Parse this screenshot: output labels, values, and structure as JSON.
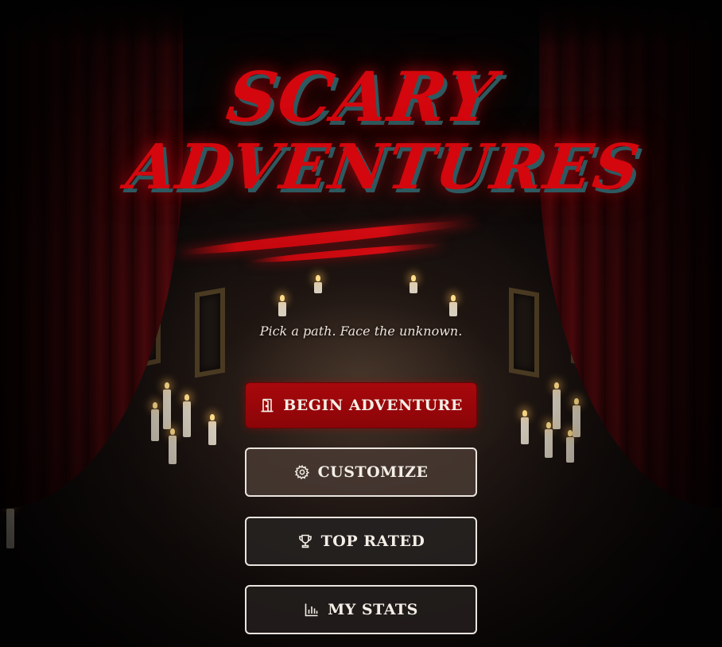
{
  "game": {
    "title_line_1": "SCARY",
    "title_line_2": "ADVENTURES",
    "tagline": "Pick a path. Face the unknown."
  },
  "menu": {
    "begin": {
      "label": "BEGIN ADVENTURE",
      "icon": "door-icon"
    },
    "customize": {
      "label": "CUSTOMIZE",
      "icon": "gear-icon"
    },
    "top_rated": {
      "label": "TOP RATED",
      "icon": "trophy-icon"
    },
    "stats": {
      "label": "MY STATS",
      "icon": "bar-chart-icon"
    }
  },
  "colors": {
    "title_red": "#d3070d",
    "title_shadow_teal": "#2d5a60",
    "primary_button": "#a8080c",
    "button_border": "#e9e4de",
    "text_light": "#f4eee6"
  }
}
